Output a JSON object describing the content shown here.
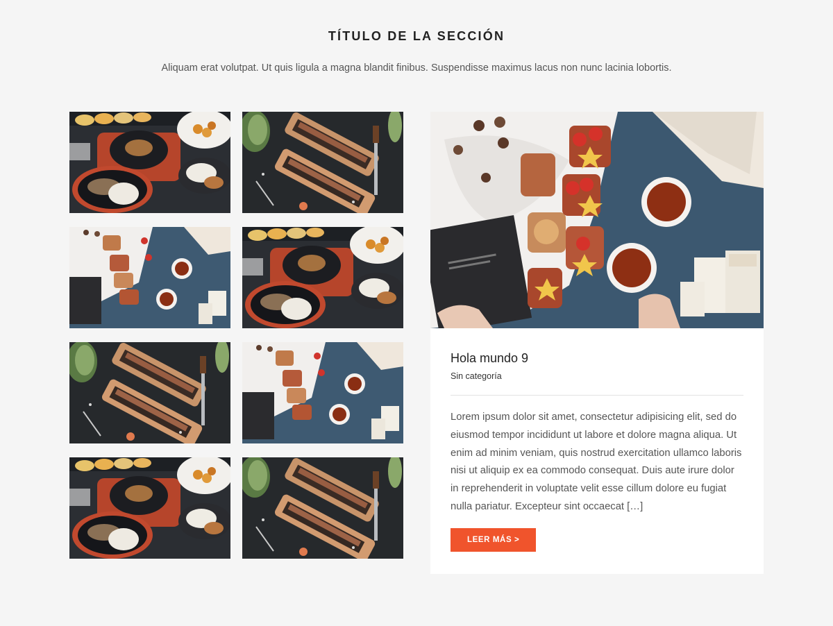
{
  "section": {
    "title": "TÍTULO DE LA SECCIÓN",
    "subtitle": "Aliquam erat volutpat. Ut quis ligula a magna blandit finibus. Suspendisse maximus lacus non nunc lacinia lobortis."
  },
  "gallery": {
    "thumbnails": [
      {
        "photo": "seafood-dinner-photo"
      },
      {
        "photo": "sushi-board-photo"
      },
      {
        "photo": "tea-toast-photo"
      },
      {
        "photo": "seafood-dinner-photo"
      },
      {
        "photo": "sushi-board-photo"
      },
      {
        "photo": "tea-toast-photo"
      },
      {
        "photo": "seafood-dinner-photo"
      },
      {
        "photo": "sushi-board-photo"
      }
    ]
  },
  "featured": {
    "photo": "tea-toast-photo",
    "title": "Hola mundo 9",
    "category": "Sin categoría",
    "excerpt": "Lorem ipsum dolor sit amet, consectetur adipisicing elit, sed do eiusmod tempor incididunt ut labore et dolore magna aliqua. Ut enim ad minim veniam, quis nostrud exercitation ullamco laboris nisi ut aliquip ex ea commodo consequat. Duis aute irure dolor in reprehenderit in voluptate velit esse cillum dolore eu fugiat nulla pariatur. Excepteur sint occaecat […]",
    "read_more_label": "LEER MÁS >"
  },
  "colors": {
    "background": "#f5f5f5",
    "card": "#ffffff",
    "accent": "#f0542c"
  }
}
